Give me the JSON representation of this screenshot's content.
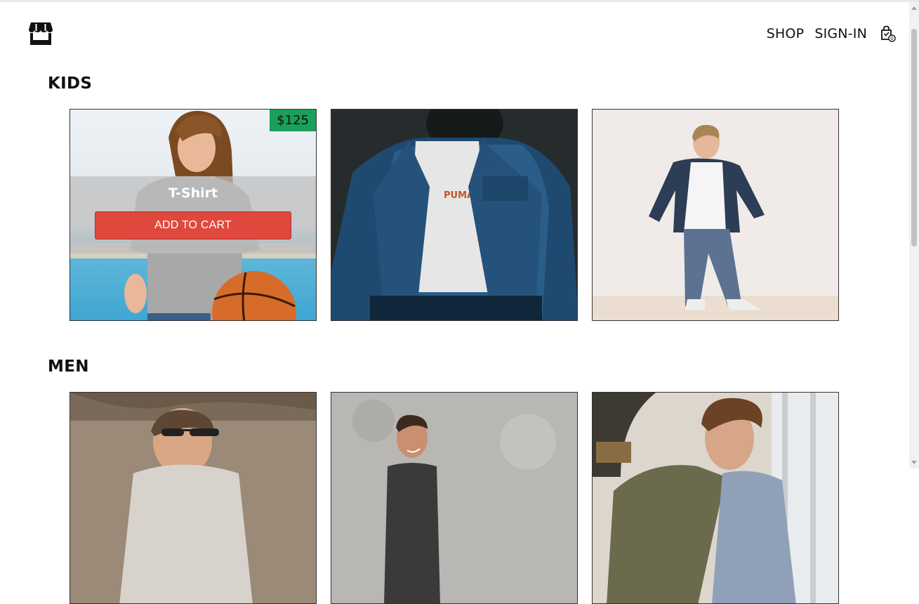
{
  "nav": {
    "shop_label": "SHOP",
    "signin_label": "SIGN-IN",
    "cart_count": "0"
  },
  "sections": [
    {
      "title": "KIDS",
      "products": [
        {
          "name": "T-Shirt",
          "price": "$125",
          "button": "ADD TO CART"
        }
      ]
    },
    {
      "title": "MEN"
    }
  ],
  "colors": {
    "price_badge": "#1aa05a",
    "add_to_cart": "#e0483e"
  }
}
